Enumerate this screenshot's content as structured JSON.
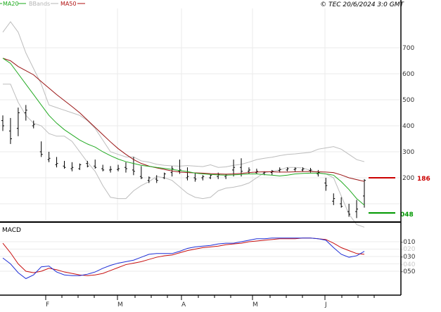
{
  "header": {
    "legend": [
      {
        "label": "MA20",
        "color": "#1aaa1a"
      },
      {
        "label": "BBands",
        "color": "#b4b4b4"
      },
      {
        "label": "MA50",
        "color": "#b01010"
      }
    ],
    "source": "© TEC 20/6/2024 3:0 GMT"
  },
  "price_panel": {
    "y_ticks": [
      "700",
      "600",
      "500",
      "400",
      "300",
      "200"
    ],
    "ma50_box": {
      "label": "186",
      "color": "#cc0000"
    },
    "ma20_box": {
      "label": "048",
      "color": "#009900"
    },
    "bar_color": "#000000",
    "ma20_color": "#22aa22",
    "ma50_color": "#9a1414",
    "bband_color": "#bdbdbd"
  },
  "macd_panel": {
    "title": "MACD",
    "y_ticks": [
      "-010",
      "-030",
      "-050"
    ],
    "faint_ticks": [
      "-020",
      "-040"
    ],
    "macd_color": "#1e2ed6",
    "signal_color": "#c81010"
  },
  "x_axis": {
    "labels": [
      "F",
      "M",
      "A",
      "M",
      "J"
    ]
  },
  "chart_data": [
    {
      "type": "line",
      "title": "",
      "xlabel": "",
      "ylabel": "",
      "x_axis_months": [
        "F",
        "M",
        "A",
        "M",
        "J"
      ],
      "ylim": [
        -20,
        760
      ],
      "y_ticks": [
        200,
        300,
        400,
        500,
        600,
        700
      ],
      "grid": true,
      "legend": "top-left",
      "series": [
        {
          "name": "MA20",
          "values": [
            660,
            640,
            600,
            560,
            520,
            480,
            440,
            410,
            385,
            365,
            345,
            330,
            318,
            300,
            285,
            272,
            262,
            255,
            248,
            244,
            240,
            236,
            232,
            228,
            224,
            218,
            215,
            213,
            211,
            210,
            211,
            213,
            215,
            215,
            212,
            210,
            207,
            210,
            215,
            217,
            218,
            218,
            215,
            210,
            185,
            155,
            120,
            95
          ]
        },
        {
          "name": "MA50",
          "values": [
            660,
            650,
            628,
            612,
            596,
            570,
            545,
            520,
            497,
            474,
            450,
            422,
            394,
            366,
            338,
            312,
            290,
            270,
            255,
            245,
            238,
            232,
            226,
            222,
            220,
            219,
            218,
            216,
            215,
            214,
            215,
            217,
            220,
            222,
            223,
            223,
            222,
            222,
            223,
            224,
            224,
            223,
            222,
            220,
            211,
            200,
            193,
            186
          ]
        },
        {
          "name": "BBands",
          "values": [
            [
              760,
              560
            ],
            [
              800,
              560
            ],
            [
              760,
              490
            ],
            [
              680,
              440
            ],
            [
              620,
              410
            ],
            [
              560,
              400
            ],
            [
              480,
              370
            ],
            [
              470,
              360
            ],
            [
              460,
              360
            ],
            [
              450,
              340
            ],
            [
              440,
              300
            ],
            [
              420,
              260
            ],
            [
              390,
              225
            ],
            [
              345,
              170
            ],
            [
              300,
              125
            ],
            [
              290,
              120
            ],
            [
              280,
              120
            ],
            [
              280,
              150
            ],
            [
              265,
              170
            ],
            [
              260,
              185
            ],
            [
              252,
              205
            ],
            [
              248,
              200
            ],
            [
              246,
              190
            ],
            [
              245,
              165
            ],
            [
              247,
              140
            ],
            [
              245,
              125
            ],
            [
              243,
              120
            ],
            [
              250,
              125
            ],
            [
              240,
              150
            ],
            [
              242,
              160
            ],
            [
              248,
              164
            ],
            [
              252,
              170
            ],
            [
              260,
              180
            ],
            [
              270,
              200
            ],
            [
              275,
              220
            ],
            [
              279,
              225
            ],
            [
              285,
              230
            ],
            [
              290,
              240
            ],
            [
              292,
              240
            ],
            [
              295,
              238
            ],
            [
              298,
              228
            ],
            [
              310,
              220
            ],
            [
              315,
              215
            ],
            [
              320,
              200
            ],
            [
              310,
              130
            ],
            [
              290,
              60
            ],
            [
              270,
              20
            ],
            [
              262,
              10
            ]
          ]
        },
        {
          "name": "",
          "values": [
            [
              440,
              380,
              420,
              400
            ],
            [
              430,
              330,
              380,
              350
            ],
            [
              470,
              360,
              390,
              450
            ],
            [
              480,
              420,
              450,
              460
            ],
            [
              420,
              390,
              400,
              405
            ],
            [
              340,
              280,
              300,
              290
            ],
            [
              300,
              260,
              270,
              275
            ],
            [
              280,
              240,
              250,
              255
            ],
            [
              265,
              235,
              245,
              240
            ],
            [
              260,
              225,
              235,
              240
            ],
            [
              255,
              230,
              235,
              250
            ],
            [
              265,
              240,
              255,
              245
            ],
            [
              270,
              235,
              245,
              240
            ],
            [
              250,
              225,
              235,
              230
            ],
            [
              245,
              220,
              230,
              232
            ],
            [
              250,
              225,
              232,
              235
            ],
            [
              260,
              220,
              240,
              235
            ],
            [
              280,
              210,
              230,
              225
            ],
            [
              245,
              195,
              205,
              200
            ],
            [
              205,
              180,
              190,
              200
            ],
            [
              210,
              180,
              195,
              190
            ],
            [
              220,
              195,
              200,
              215
            ],
            [
              245,
              205,
              220,
              235
            ],
            [
              270,
              215,
              225,
              230
            ],
            [
              240,
              190,
              200,
              205
            ],
            [
              220,
              185,
              200,
              195
            ],
            [
              210,
              190,
              200,
              205
            ],
            [
              212,
              195,
              200,
              210
            ],
            [
              220,
              195,
              205,
              212
            ],
            [
              215,
              195,
              205,
              210
            ],
            [
              270,
              205,
              230,
              240
            ],
            [
              275,
              205,
              240,
              225
            ],
            [
              240,
              215,
              225,
              230
            ],
            [
              235,
              215,
              220,
              225
            ],
            [
              225,
              210,
              218,
              222
            ],
            [
              230,
              210,
              220,
              225
            ],
            [
              240,
              220,
              228,
              232
            ],
            [
              240,
              225,
              230,
              235
            ],
            [
              240,
              225,
              232,
              235
            ],
            [
              240,
              224,
              230,
              234
            ],
            [
              238,
              220,
              228,
              230
            ],
            [
              230,
              205,
              215,
              220
            ],
            [
              200,
              150,
              180,
              170
            ],
            [
              140,
              95,
              110,
              120
            ],
            [
              125,
              85,
              100,
              90
            ],
            [
              100,
              50,
              70,
              60
            ],
            [
              115,
              45,
              70,
              80
            ],
            [
              195,
              85,
              130,
              190
            ]
          ]
        }
      ]
    },
    {
      "type": "line",
      "title": "MACD",
      "xlabel": "",
      "ylabel": "",
      "ylim": [
        -60,
        0
      ],
      "y_ticks": [
        -50,
        -40,
        -30,
        -20,
        -10
      ],
      "grid": true,
      "series": [
        {
          "name": "",
          "values": [
            -32,
            -40,
            -52,
            -60,
            -55,
            -44,
            -43,
            -51,
            -55,
            -56,
            -56,
            -54,
            -51,
            -46,
            -42,
            -39,
            -37,
            -35,
            -31,
            -27,
            -26,
            -26,
            -26,
            -23,
            -19,
            -17,
            -16,
            -15,
            -13,
            -12,
            -12,
            -10,
            -8,
            -6,
            -6,
            -5,
            -5,
            -5,
            -5,
            -5,
            -5,
            -6,
            -8,
            -18,
            -27,
            -31,
            -29,
            -23
          ]
        },
        {
          "name": "",
          "values": [
            -12,
            -25,
            -40,
            -50,
            -52,
            -50,
            -46,
            -48,
            -51,
            -53,
            -55,
            -56,
            -55,
            -53,
            -49,
            -45,
            -41,
            -39,
            -37,
            -34,
            -31,
            -29,
            -28,
            -25,
            -22,
            -20,
            -18,
            -17,
            -16,
            -14,
            -13,
            -12,
            -10,
            -9,
            -8,
            -7,
            -6,
            -6,
            -6,
            -5,
            -5,
            -6,
            -7,
            -12,
            -18,
            -22,
            -26,
            -27
          ]
        }
      ]
    }
  ]
}
